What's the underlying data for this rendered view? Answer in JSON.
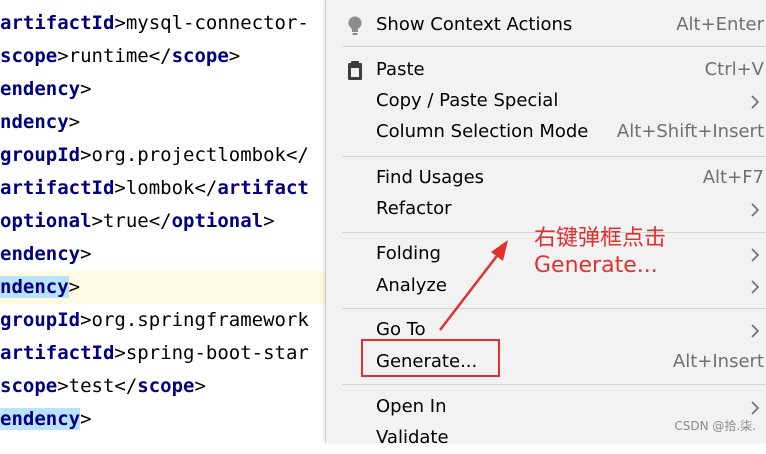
{
  "editor": {
    "lines": [
      {
        "tag1": "artifactId",
        "text": ">mysql-connector-",
        "tag2": "",
        "tail": ""
      },
      {
        "tag1": "scope",
        "text": ">runtime</",
        "tag2": "scope",
        "tail": ">"
      },
      {
        "tag1": "endency",
        "text": ">",
        "tag2": "",
        "tail": ""
      },
      {
        "tag1": "ndency",
        "text": ">",
        "tag2": "",
        "tail": ""
      },
      {
        "tag1": "groupId",
        "text": ">org.projectlombok</",
        "tag2": "",
        "tail": ""
      },
      {
        "tag1": "artifactId",
        "text": ">lombok</",
        "tag2": "artifact",
        "tail": ""
      },
      {
        "tag1": "optional",
        "text": ">true</",
        "tag2": "optional",
        "tail": ">"
      },
      {
        "tag1": "endency",
        "text": ">",
        "tag2": "",
        "tail": ""
      },
      {
        "tag1": "ndency",
        "text": ">",
        "tag2": "",
        "tail": ""
      },
      {
        "tag1": "groupId",
        "text": ">org.springframework",
        "tag2": "",
        "tail": ""
      },
      {
        "tag1": "artifactId",
        "text": ">spring-boot-star",
        "tag2": "",
        "tail": ""
      },
      {
        "tag1": "scope",
        "text": ">test</",
        "tag2": "scope",
        "tail": ">"
      },
      {
        "tag1": "endency",
        "text": ">",
        "tag2": "",
        "tail": ""
      }
    ]
  },
  "menu": {
    "items": [
      {
        "label": "Show Context Actions",
        "shortcut": "Alt+Enter"
      },
      {
        "label": "Paste",
        "shortcut": "Ctrl+V"
      },
      {
        "label": "Copy / Paste Special",
        "shortcut": ""
      },
      {
        "label": "Column Selection Mode",
        "shortcut": "Alt+Shift+Insert"
      },
      {
        "label": "Find Usages",
        "shortcut": "Alt+F7"
      },
      {
        "label": "Refactor",
        "shortcut": ""
      },
      {
        "label": "Folding",
        "shortcut": ""
      },
      {
        "label": "Analyze",
        "shortcut": ""
      },
      {
        "label": "Go To",
        "shortcut": ""
      },
      {
        "label": "Generate...",
        "shortcut": "Alt+Insert"
      },
      {
        "label": "Open In",
        "shortcut": ""
      },
      {
        "label": "Validate",
        "shortcut": ""
      }
    ]
  },
  "annotation": {
    "line1": "右键弹框点击",
    "line2": "Generate...",
    "color": "#e03131"
  },
  "watermark": "CSDN @拾.柒."
}
